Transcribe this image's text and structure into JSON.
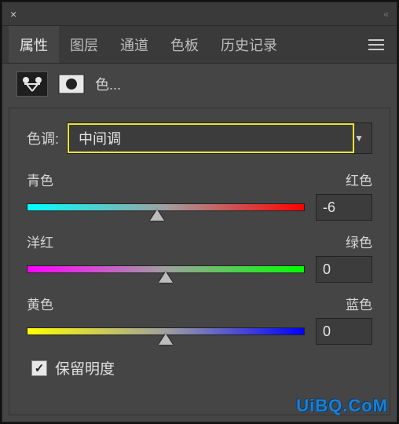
{
  "tabs": {
    "properties": "属性",
    "layers": "图层",
    "channels": "通道",
    "swatches": "色板",
    "history": "历史记录"
  },
  "adjustment": {
    "name": "色..."
  },
  "tone": {
    "label": "色调:",
    "value": "中间调"
  },
  "sliders": {
    "cr": {
      "left": "青色",
      "right": "红色",
      "value": "-6",
      "pos": 47
    },
    "mg": {
      "left": "洋红",
      "right": "绿色",
      "value": "0",
      "pos": 50
    },
    "yb": {
      "left": "黄色",
      "right": "蓝色",
      "value": "0",
      "pos": 50
    }
  },
  "preserve": {
    "label": "保留明度",
    "checked": true
  },
  "watermark": "UiBQ.CoM"
}
